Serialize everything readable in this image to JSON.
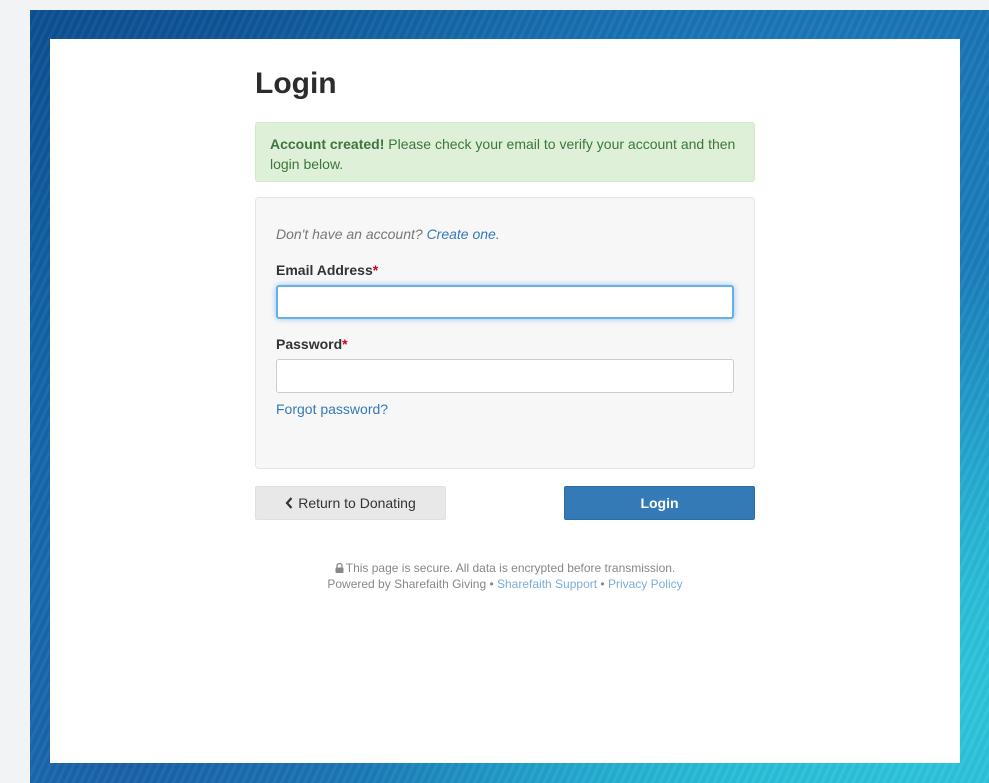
{
  "page": {
    "title": "Login"
  },
  "alert": {
    "strong": "Account created!",
    "message": " Please check your email to verify your account and then login below."
  },
  "form": {
    "no_account_text": "Don't have an account? ",
    "create_link": "Create one.",
    "email_label": "Email Address",
    "email_value": "",
    "password_label": "Password",
    "password_value": "",
    "required_marker": "*",
    "forgot_link": "Forgot password?"
  },
  "buttons": {
    "back_label": "Return to Donating",
    "login_label": "Login"
  },
  "footer": {
    "secure_text": "This page is secure. All data is encrypted before transmission.",
    "powered_text": "Powered by Sharefaith Giving",
    "separator": " • ",
    "support_link": "Sharefaith Support",
    "privacy_link": "Privacy Policy"
  },
  "colors": {
    "primary": "#337ab7",
    "alert_bg": "#dff0d8",
    "alert_text": "#3c763d",
    "required": "#d0021b"
  },
  "icons": {
    "back": "chevron-left-icon",
    "secure": "lock-icon"
  }
}
